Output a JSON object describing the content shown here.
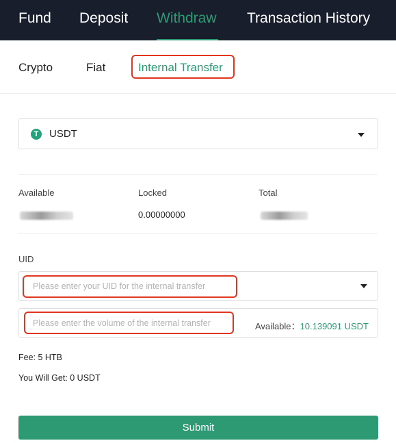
{
  "nav": {
    "tabs": [
      {
        "label": "Fund"
      },
      {
        "label": "Deposit"
      },
      {
        "label": "Withdraw",
        "active": true
      },
      {
        "label": "Transaction History"
      }
    ]
  },
  "subtabs": [
    {
      "label": "Crypto"
    },
    {
      "label": "Fiat"
    },
    {
      "label": "Internal Transfer",
      "active": true
    }
  ],
  "coin": {
    "symbol": "USDT",
    "icon": "tether-icon",
    "icon_glyph": "T"
  },
  "balances": {
    "available_label": "Available",
    "locked_label": "Locked",
    "locked_value": "0.00000000",
    "total_label": "Total"
  },
  "uid": {
    "label": "UID",
    "placeholder": "Please enter your UID for the internal transfer"
  },
  "volume": {
    "placeholder": "Please enter the volume of the internal transfer",
    "available_label": "Available：",
    "available_value": "10.139091 USDT"
  },
  "fee": "Fee: 5 HTB",
  "you_will_get": "You Will Get: 0 USDT",
  "submit_label": "Submit",
  "colors": {
    "accent": "#2e9a74",
    "nav_bg": "#181e2c",
    "highlight": "#e0351e"
  }
}
